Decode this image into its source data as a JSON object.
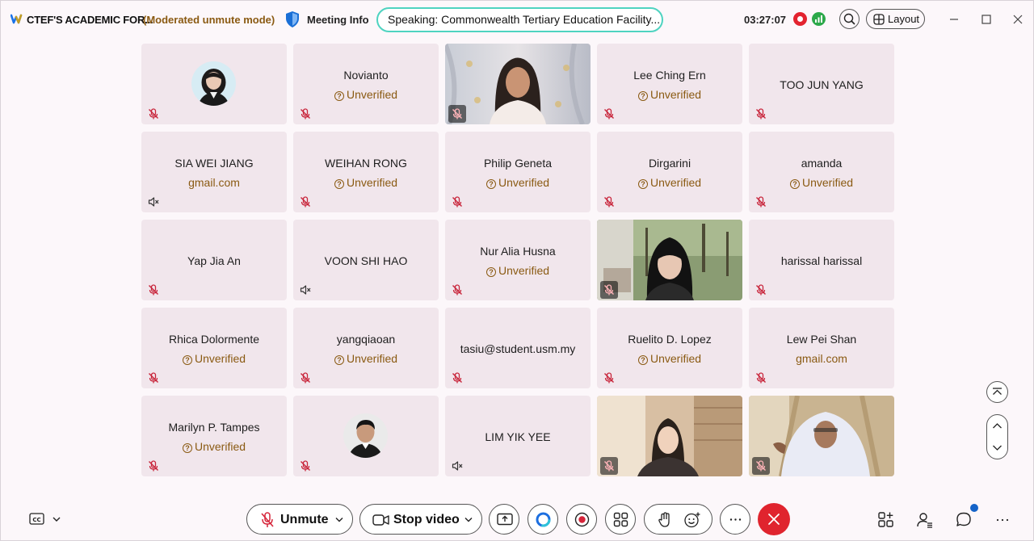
{
  "titlebar": {
    "app_title": "CTEF'S ACADEMIC FOR...",
    "mode": "(Moderated unmute mode)",
    "meeting_info": "Meeting Info",
    "speaking": "Speaking: Commonwealth Tertiary Education Facility...",
    "clock": "03:27:07",
    "layout_label": "Layout"
  },
  "participants": [
    {
      "name": "",
      "sub": "",
      "kind": "avatar-woman",
      "audio": "muted"
    },
    {
      "name": "Novianto",
      "sub": "Unverified",
      "kind": "text",
      "audio": "muted"
    },
    {
      "name": "",
      "sub": "",
      "kind": "video-1",
      "audio": "muted"
    },
    {
      "name": "Lee Ching Ern",
      "sub": "Unverified",
      "kind": "text",
      "audio": "muted"
    },
    {
      "name": "TOO JUN YANG",
      "sub": "",
      "kind": "text",
      "audio": "muted"
    },
    {
      "name": "SIA WEI JIANG",
      "sub": "gmail.com",
      "kind": "text",
      "audio": "speaker-off"
    },
    {
      "name": "WEIHAN RONG",
      "sub": "Unverified",
      "kind": "text",
      "audio": "muted"
    },
    {
      "name": "Philip Geneta",
      "sub": "Unverified",
      "kind": "text",
      "audio": "muted"
    },
    {
      "name": "Dirgarini",
      "sub": "Unverified",
      "kind": "text",
      "audio": "muted"
    },
    {
      "name": "amanda",
      "sub": "Unverified",
      "kind": "text",
      "audio": "muted"
    },
    {
      "name": "Yap Jia An",
      "sub": "",
      "kind": "text",
      "audio": "muted"
    },
    {
      "name": "VOON SHI HAO",
      "sub": "",
      "kind": "text",
      "audio": "speaker-off"
    },
    {
      "name": "Nur Alia Husna",
      "sub": "Unverified",
      "kind": "text",
      "audio": "muted"
    },
    {
      "name": "",
      "sub": "",
      "kind": "video-2",
      "audio": "muted"
    },
    {
      "name": "harissal harissal",
      "sub": "",
      "kind": "text",
      "audio": "muted"
    },
    {
      "name": "Rhica Dolormente",
      "sub": "Unverified",
      "kind": "text",
      "audio": "muted"
    },
    {
      "name": "yangqiaoan",
      "sub": "Unverified",
      "kind": "text",
      "audio": "muted"
    },
    {
      "name": "tasiu@student.usm.my",
      "sub": "",
      "kind": "text",
      "audio": "muted"
    },
    {
      "name": "Ruelito D. Lopez",
      "sub": "Unverified",
      "kind": "text",
      "audio": "muted"
    },
    {
      "name": "Lew Pei Shan",
      "sub": "gmail.com",
      "kind": "text",
      "audio": "muted"
    },
    {
      "name": "Marilyn P. Tampes",
      "sub": "Unverified",
      "kind": "text",
      "audio": "muted"
    },
    {
      "name": "",
      "sub": "",
      "kind": "avatar-man",
      "audio": "muted"
    },
    {
      "name": "LIM YIK YEE",
      "sub": "",
      "kind": "text",
      "audio": "speaker-off"
    },
    {
      "name": "",
      "sub": "",
      "kind": "video-3",
      "audio": "muted"
    },
    {
      "name": "",
      "sub": "",
      "kind": "video-4",
      "audio": "muted"
    }
  ],
  "controls": {
    "unmute_label": "Unmute",
    "stop_video_label": "Stop video"
  },
  "colors": {
    "accent_teal": "#4ed3c0",
    "leave_red": "#e0242e",
    "unverified_brown": "#8a5a12",
    "tile_bg": "#f1e6ec"
  }
}
